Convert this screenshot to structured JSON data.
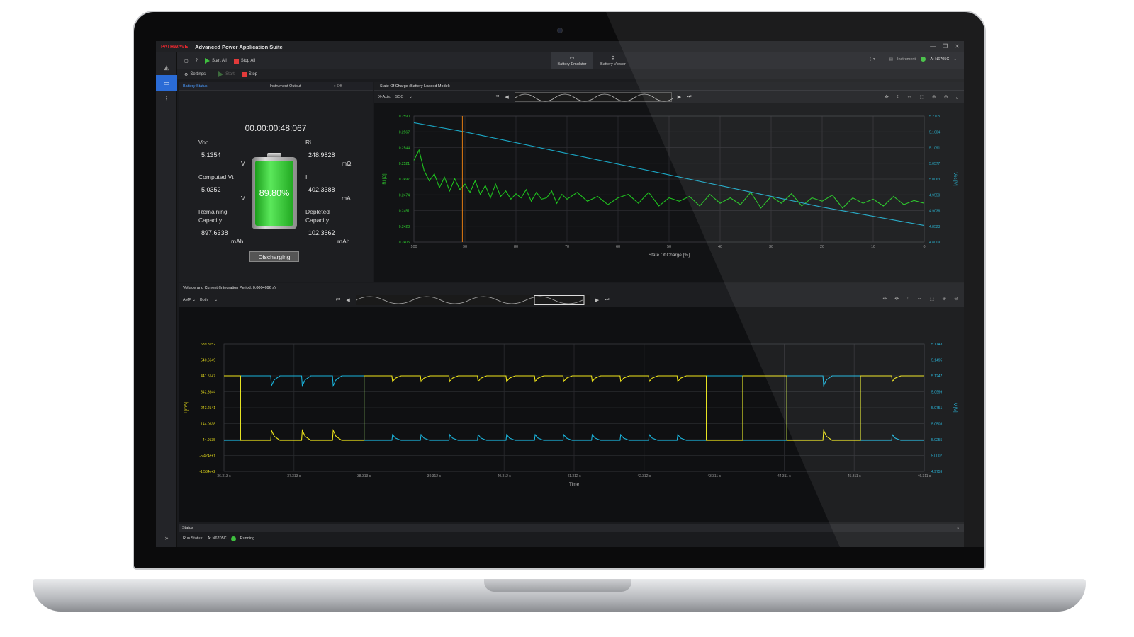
{
  "app": {
    "logo": "PATHWAVE",
    "title": "Advanced Power Application Suite"
  },
  "toolbar": {
    "start_all": "Start All",
    "stop_all": "Stop All",
    "settings": "Settings",
    "start": "Start",
    "stop": "Stop",
    "help": "?",
    "tabs": [
      {
        "label": "Battery Emulator",
        "icon": "battery-icon",
        "active": true
      },
      {
        "label": "Battery Viewer",
        "icon": "battery-viewer-icon",
        "active": false
      }
    ],
    "instrument_label": "Instrument:",
    "instrument_value": "A: N6705C"
  },
  "battery_status": {
    "tab_status": "Battery Status",
    "tab_output": "Instrument Output",
    "output_state": "Off",
    "timer": "00.00:00:48:067",
    "voc_label": "Voc",
    "voc_value": "5.1354",
    "voc_unit": "V",
    "ri_label": "Ri",
    "ri_value": "248.9828",
    "ri_unit": "mΩ",
    "cvt_label": "Computed Vt",
    "cvt_value": "5.0352",
    "cvt_unit": "V",
    "i_label": "I",
    "i_value": "402.3388",
    "i_unit": "mA",
    "rem_label_1": "Remaining",
    "rem_label_2": "Capacity",
    "rem_value": "897.6338",
    "rem_unit": "mAh",
    "dep_label_1": "Depleted",
    "dep_label_2": "Capacity",
    "dep_value": "102.3662",
    "dep_unit": "mAh",
    "percent_text": "89.80%",
    "percent": 0.898,
    "button": "Discharging"
  },
  "soc_chart": {
    "title": "State Of Charge (Battery Loaded Model)",
    "x_axis_label": "X-Axis:",
    "x_axis_value": "SOC"
  },
  "vc_chart": {
    "title": "Voltage and Current (Integration Period: 0.0004096 s)",
    "mode": "AMP",
    "channel": "Both"
  },
  "status": {
    "header": "Status",
    "run_label": "Run Status:",
    "instrument": "A: N6705C",
    "state": "Running"
  },
  "colors": {
    "ri_green": "#1fc41f",
    "voc_cyan": "#1aa6c4",
    "current_yellow": "#f0e61a",
    "voltage_cyan": "#1ab4dc",
    "marker_orange": "#e07a12"
  },
  "chart_data": [
    {
      "type": "line",
      "title": "State Of Charge (Battery Loaded Model)",
      "xlabel": "State Of Charge [%]",
      "ylabel": "Ri [Ω]",
      "y2label": "Voc [V]",
      "x_ticks": [
        "100",
        "90",
        "80",
        "70",
        "60",
        "50",
        "40",
        "30",
        "20",
        "10",
        "0"
      ],
      "y_ticks": [
        "0.2590",
        "0.2567",
        "0.2544",
        "0.2521",
        "0.2497",
        "0.2474",
        "0.2451",
        "0.2428",
        "0.2405"
      ],
      "y2_ticks": [
        "5.2118",
        "5.1604",
        "5.1091",
        "5.0577",
        "5.0063",
        "4.9550",
        "4.9036",
        "4.8523",
        "4.8009"
      ],
      "xlim": [
        100,
        0
      ],
      "ylim": [
        0.2405,
        0.259
      ],
      "y2lim": [
        4.8009,
        5.2118
      ],
      "cursor_x": 90.5,
      "series": [
        {
          "name": "Ri",
          "axis": "left",
          "x": [
            100,
            99,
            98,
            97,
            96,
            95,
            94,
            93,
            92,
            91,
            90,
            89,
            88,
            87,
            86,
            85,
            84,
            83,
            82,
            81,
            80,
            79,
            78,
            77,
            76,
            75,
            74,
            73,
            72,
            71,
            70,
            68,
            66,
            64,
            62,
            60,
            58,
            56,
            54,
            52,
            50,
            48,
            46,
            44,
            42,
            40,
            38,
            36,
            34,
            32,
            30,
            28,
            26,
            24,
            22,
            20,
            18,
            16,
            14,
            12,
            10,
            8,
            6,
            4,
            2,
            0
          ],
          "y": [
            0.2525,
            0.254,
            0.251,
            0.2495,
            0.2505,
            0.2485,
            0.25,
            0.248,
            0.2498,
            0.2482,
            0.249,
            0.2478,
            0.2495,
            0.2475,
            0.2488,
            0.247,
            0.249,
            0.2472,
            0.248,
            0.2468,
            0.2476,
            0.247,
            0.2482,
            0.2465,
            0.2478,
            0.2468,
            0.247,
            0.248,
            0.2462,
            0.2475,
            0.2468,
            0.2478,
            0.2465,
            0.2472,
            0.246,
            0.247,
            0.2475,
            0.2462,
            0.2478,
            0.2458,
            0.247,
            0.2465,
            0.2472,
            0.2458,
            0.2475,
            0.2462,
            0.247,
            0.246,
            0.2478,
            0.2455,
            0.2472,
            0.2462,
            0.2476,
            0.2458,
            0.247,
            0.2465,
            0.2474,
            0.2455,
            0.247,
            0.2462,
            0.2468,
            0.2458,
            0.2472,
            0.246,
            0.2466,
            0.2462
          ]
        },
        {
          "name": "Voc",
          "axis": "right",
          "x": [
            100,
            90,
            80,
            70,
            60,
            50,
            40,
            30,
            20,
            10,
            0
          ],
          "y": [
            5.19,
            5.16,
            5.125,
            5.09,
            5.055,
            5.02,
            4.985,
            4.95,
            4.915,
            4.885,
            4.855
          ]
        }
      ]
    },
    {
      "type": "line",
      "title": "Voltage and Current (Integration Period: 0.0004096 s)",
      "xlabel": "Time",
      "ylabel": "I [mA]",
      "y2label": "V [V]",
      "x_ticks": [
        "36.313 s",
        "37.313 s",
        "38.313 s",
        "39.312 s",
        "40.312 s",
        "41.312 s",
        "42.312 s",
        "43.311 s",
        "44.311 s",
        "45.311 s",
        "46.311 s"
      ],
      "y_ticks": [
        "639.8152",
        "540.6649",
        "441.5147",
        "342.3644",
        "243.2141",
        "144.0638",
        "44.9135",
        "-5.424e+1",
        "-1.534e+2"
      ],
      "y2_ticks": [
        "5.1743",
        "5.1495",
        "5.1247",
        "5.0999",
        "5.0751",
        "5.0503",
        "5.0255",
        "5.0007",
        "4.9759"
      ],
      "xlim": [
        36.313,
        46.311
      ],
      "ylim": [
        -153.4,
        639.8
      ],
      "y2lim": [
        4.9759,
        5.1743
      ],
      "series": [
        {
          "name": "I",
          "axis": "left",
          "segments": [
            {
              "x0": 36.313,
              "x1": 36.55,
              "level": "high"
            },
            {
              "x0": 36.55,
              "x1": 38.313,
              "level": "low"
            },
            {
              "x0": 38.313,
              "x1": 43.2,
              "level": "high"
            },
            {
              "x0": 43.2,
              "x1": 43.72,
              "level": "low"
            },
            {
              "x0": 43.72,
              "x1": 44.35,
              "level": "high"
            },
            {
              "x0": 44.35,
              "x1": 45.4,
              "level": "low"
            },
            {
              "x0": 45.4,
              "x1": 46.311,
              "level": "high"
            }
          ],
          "high": 441.5,
          "low": 40
        }
      ]
    }
  ]
}
